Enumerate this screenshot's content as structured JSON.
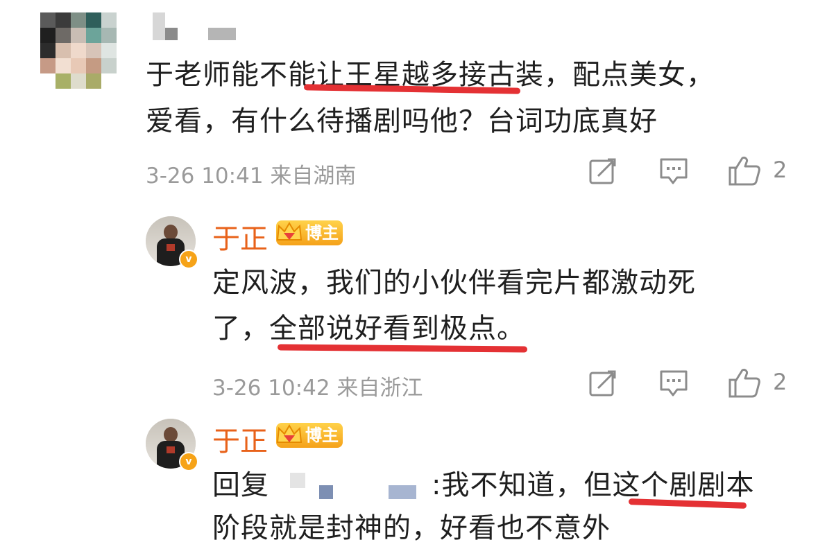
{
  "comment1": {
    "text_line1": "于老师能不能让王星越多接古装，配点美女，",
    "text_line2": "爱看，有什么待播剧吗他？台词功底真好",
    "meta": "3-26 10:41 来自湖南",
    "like_count": "2"
  },
  "reply1": {
    "author": "于正",
    "badge": "博主",
    "text_line1": "定风波，我们的小伙伴看完片都激动死",
    "text_line2": "了，全部说好看到极点。",
    "meta": "3-26 10:42 来自浙江",
    "like_count": "2"
  },
  "reply2": {
    "author": "于正",
    "badge": "博主",
    "reply_prefix": "回复",
    "text_line1": ":我不知道，但这个剧剧本",
    "text_line2_partial": "阶段就是封神的，好看也不意外"
  },
  "icons": {
    "repost": "edit-share-icon",
    "comment": "comment-icon",
    "like": "thumbs-up-icon",
    "verified": "verified-v-icon",
    "crown": "crown-icon"
  },
  "colors": {
    "author": "#e8621a",
    "meta": "#9a9a9a",
    "highlight_underline": "#e43134",
    "badge_gold": "#f5a21a"
  }
}
